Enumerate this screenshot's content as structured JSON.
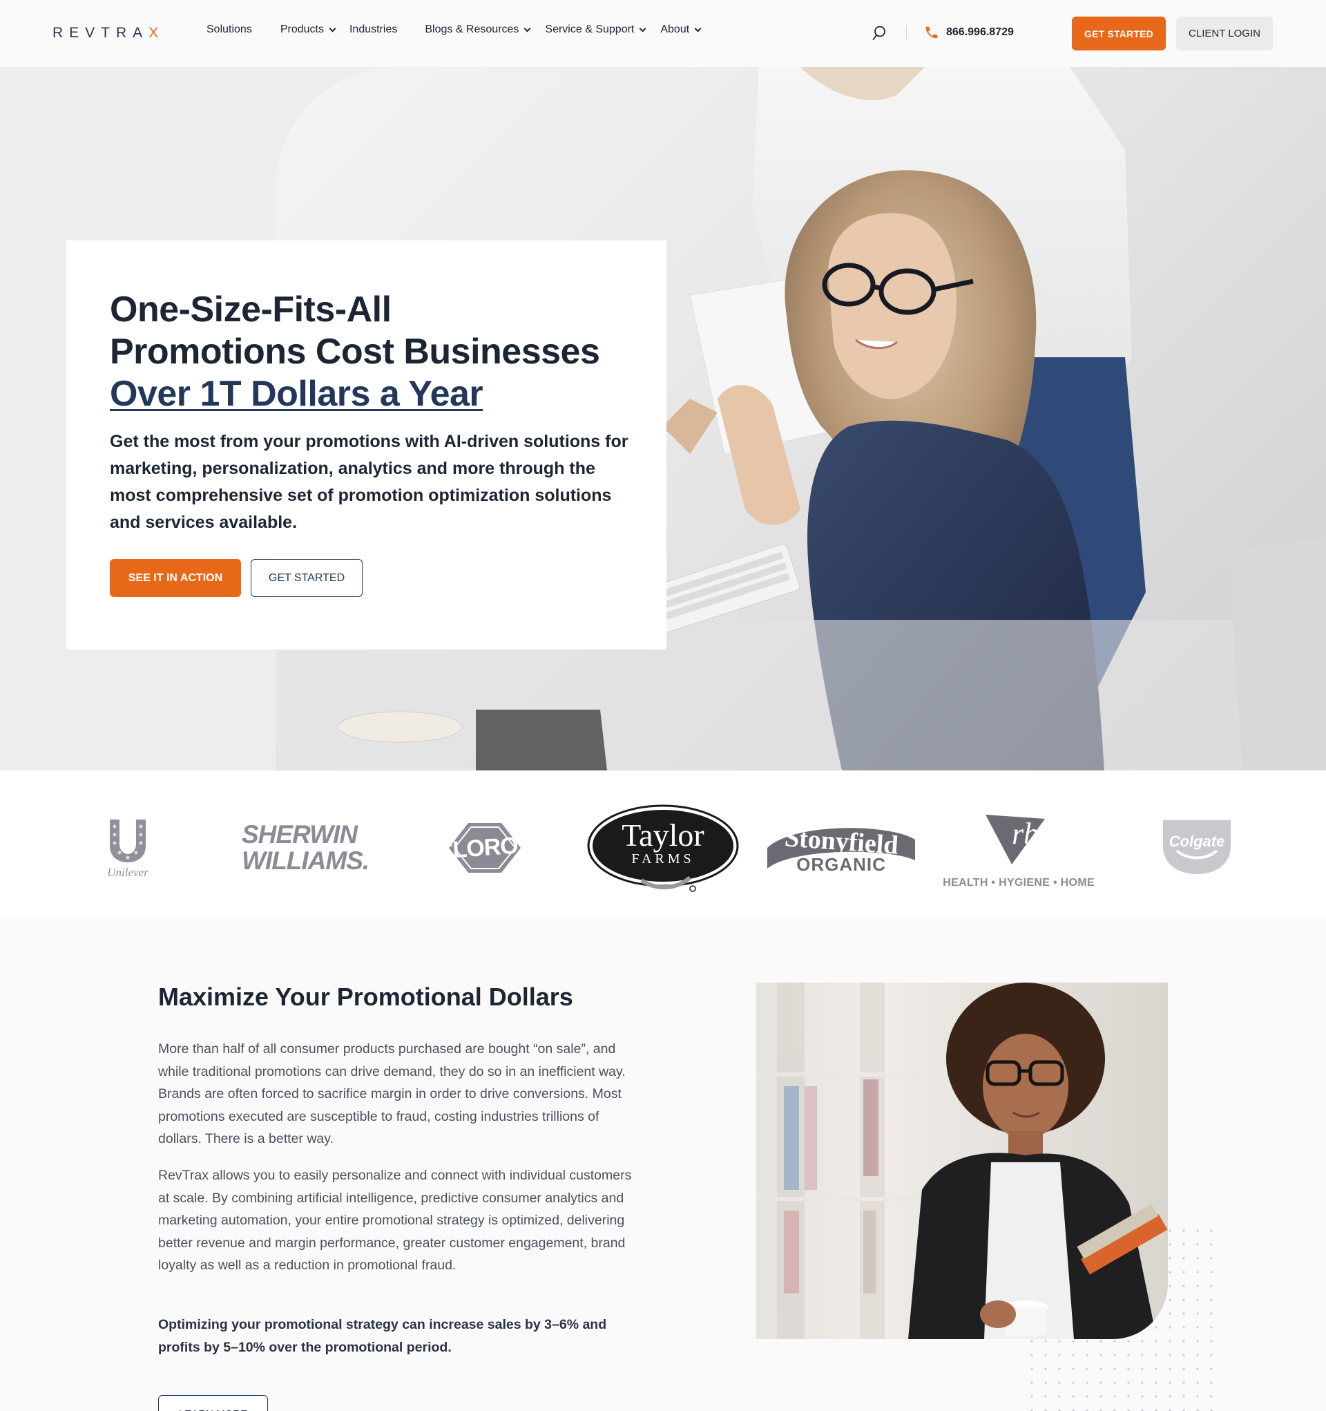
{
  "header": {
    "logo_main": "REVTRA",
    "logo_accent": "X",
    "nav": [
      {
        "label": "Solutions",
        "dropdown": false
      },
      {
        "label": "Products",
        "dropdown": true
      },
      {
        "label": "Industries",
        "dropdown": false
      },
      {
        "label": "Blogs & Resources",
        "dropdown": true
      },
      {
        "label": "Service & Support",
        "dropdown": true
      },
      {
        "label": "About",
        "dropdown": true
      }
    ],
    "phone": "866.996.8729",
    "get_started": "GET STARTED",
    "client_login": "CLIENT LOGIN"
  },
  "hero": {
    "title_line1": "One-Size-Fits-All",
    "title_line2": "Promotions Cost Businesses",
    "title_link": "Over 1T Dollars a Year",
    "subtitle": "Get the most from your promotions with AI-driven solutions for marketing, personalization, analytics and more through the most comprehensive set of promotion optimization solutions and services available.",
    "btn_primary": "SEE IT IN ACTION",
    "btn_secondary": "GET STARTED"
  },
  "logos": {
    "unilever": "Unilever",
    "sherwin_line1": "SHERWIN",
    "sherwin_line2": "WILLIAMS.",
    "clorox": "CLOROX",
    "taylor_main": "Taylor",
    "taylor_sub": "FARMS",
    "stonyfield_main": "Stonyfield",
    "stonyfield_sub": "ORGANIC",
    "rb_mark": "rb",
    "rb_tagline": "HEALTH • HYGIENE • HOME",
    "colgate": "Colgate"
  },
  "maximize": {
    "title": "Maximize Your Promotional Dollars",
    "para1": "More than half of all consumer products purchased are bought “on sale”, and while traditional promotions can drive demand, they do so in an inefficient way. Brands are often forced to sacrifice margin in order to drive conversions. Most promotions executed are susceptible to fraud, costing industries trillions of dollars. There is a better way.",
    "para2": "RevTrax allows you to easily personalize and connect with individual customers at scale. By combining artificial intelligence, predictive consumer analytics and marketing automation, your entire promotional strategy is optimized, delivering better revenue and margin performance, greater customer engagement, brand loyalty as well as a reduction in promotional fraud.",
    "para3": "Optimizing your promotional strategy can increase sales by 3–6% and profits by 5–10% over the promotional period.",
    "learn_more": "LEARN MORE"
  },
  "colors": {
    "accent": "#e8681a",
    "navy": "#22375a",
    "text": "#1c2533"
  }
}
